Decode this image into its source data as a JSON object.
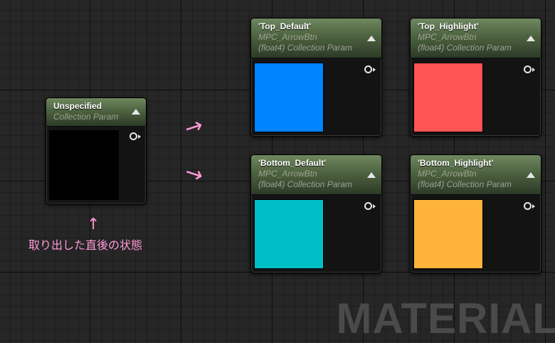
{
  "nodes": [
    {
      "id": "unspecified",
      "title": "Unspecified",
      "lines": [
        "Collection Param"
      ],
      "color": "#000000"
    },
    {
      "id": "top-default",
      "title": "'Top_Default'",
      "lines": [
        "MPC_ArrowBtn",
        "(float4) Collection Param"
      ],
      "color": "#0084ff"
    },
    {
      "id": "top-highlight",
      "title": "'Top_Highlight'",
      "lines": [
        "MPC_ArrowBtn",
        "(float4) Collection Param"
      ],
      "color": "#ff5454"
    },
    {
      "id": "bottom-default",
      "title": "'Bottom_Default'",
      "lines": [
        "MPC_ArrowBtn",
        "(float4) Collection Param"
      ],
      "color": "#00bec8"
    },
    {
      "id": "bottom-highlight",
      "title": "'Bottom_Highlight'",
      "lines": [
        "MPC_ArrowBtn",
        "(float4) Collection Param"
      ],
      "color": "#ffb33a"
    }
  ],
  "annotation": {
    "arrow_right": "→",
    "arrow_up": "↑",
    "text": "取り出した直後の状態",
    "color": "#ff9ad6"
  },
  "watermark": "MATERIAL",
  "theme": {
    "graph_background": "#262626",
    "node_header_green": "#4d6340"
  }
}
